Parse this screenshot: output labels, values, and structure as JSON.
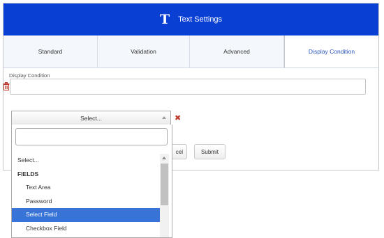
{
  "header": {
    "icon": "text-icon",
    "icon_glyph": "T",
    "title": "Text Settings",
    "background": "#0a3fd4"
  },
  "tabs": [
    {
      "label": "Standard",
      "active": false
    },
    {
      "label": "Validation",
      "active": false
    },
    {
      "label": "Advanced",
      "active": false
    },
    {
      "label": "Display Condition",
      "active": true
    }
  ],
  "display_condition": {
    "label": "Display Condition",
    "value": "",
    "delete_icon": "trash-icon"
  },
  "select": {
    "selected_label": "Select...",
    "search_value": "",
    "remove_icon": "close-icon",
    "options": [
      {
        "label": "Select...",
        "type": "option"
      },
      {
        "label": "FIELDS",
        "type": "group"
      },
      {
        "label": "Text Area",
        "type": "sub"
      },
      {
        "label": "Password",
        "type": "sub"
      },
      {
        "label": "Select Field",
        "type": "sub",
        "highlighted": true
      },
      {
        "label": "Checkbox Field",
        "type": "sub"
      }
    ]
  },
  "buttons": {
    "cancel_label": "Cancel",
    "cancel_visible_label": "cel",
    "submit_label": "Submit"
  },
  "colors": {
    "highlight": "#3874d8",
    "delete": "#c0392b",
    "active_tab_text": "#2b54b8"
  }
}
